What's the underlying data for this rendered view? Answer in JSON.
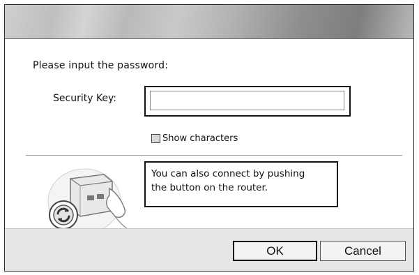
{
  "dialog": {
    "prompt": "Please input the password:",
    "security_key_label": "Security Key:",
    "security_key_value": "",
    "show_characters_label": "Show characters",
    "show_characters_checked": false,
    "push_button_note": {
      "line1": "You can also connect by pushing",
      "line2": "the button on the router."
    },
    "push_button_icon": "router-push-button-icon",
    "ok_label": "OK",
    "cancel_label": "Cancel"
  }
}
